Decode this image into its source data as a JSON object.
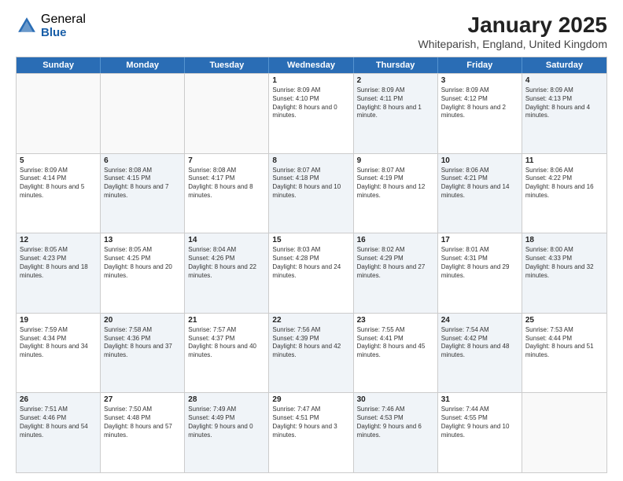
{
  "logo": {
    "general": "General",
    "blue": "Blue"
  },
  "title": {
    "month": "January 2025",
    "location": "Whiteparish, England, United Kingdom"
  },
  "header_days": [
    "Sunday",
    "Monday",
    "Tuesday",
    "Wednesday",
    "Thursday",
    "Friday",
    "Saturday"
  ],
  "weeks": [
    [
      {
        "day": "",
        "sunrise": "",
        "sunset": "",
        "daylight": "",
        "shaded": false,
        "empty": true
      },
      {
        "day": "",
        "sunrise": "",
        "sunset": "",
        "daylight": "",
        "shaded": false,
        "empty": true
      },
      {
        "day": "",
        "sunrise": "",
        "sunset": "",
        "daylight": "",
        "shaded": false,
        "empty": true
      },
      {
        "day": "1",
        "sunrise": "Sunrise: 8:09 AM",
        "sunset": "Sunset: 4:10 PM",
        "daylight": "Daylight: 8 hours and 0 minutes.",
        "shaded": false,
        "empty": false
      },
      {
        "day": "2",
        "sunrise": "Sunrise: 8:09 AM",
        "sunset": "Sunset: 4:11 PM",
        "daylight": "Daylight: 8 hours and 1 minute.",
        "shaded": true,
        "empty": false
      },
      {
        "day": "3",
        "sunrise": "Sunrise: 8:09 AM",
        "sunset": "Sunset: 4:12 PM",
        "daylight": "Daylight: 8 hours and 2 minutes.",
        "shaded": false,
        "empty": false
      },
      {
        "day": "4",
        "sunrise": "Sunrise: 8:09 AM",
        "sunset": "Sunset: 4:13 PM",
        "daylight": "Daylight: 8 hours and 4 minutes.",
        "shaded": true,
        "empty": false
      }
    ],
    [
      {
        "day": "5",
        "sunrise": "Sunrise: 8:09 AM",
        "sunset": "Sunset: 4:14 PM",
        "daylight": "Daylight: 8 hours and 5 minutes.",
        "shaded": false,
        "empty": false
      },
      {
        "day": "6",
        "sunrise": "Sunrise: 8:08 AM",
        "sunset": "Sunset: 4:15 PM",
        "daylight": "Daylight: 8 hours and 7 minutes.",
        "shaded": true,
        "empty": false
      },
      {
        "day": "7",
        "sunrise": "Sunrise: 8:08 AM",
        "sunset": "Sunset: 4:17 PM",
        "daylight": "Daylight: 8 hours and 8 minutes.",
        "shaded": false,
        "empty": false
      },
      {
        "day": "8",
        "sunrise": "Sunrise: 8:07 AM",
        "sunset": "Sunset: 4:18 PM",
        "daylight": "Daylight: 8 hours and 10 minutes.",
        "shaded": true,
        "empty": false
      },
      {
        "day": "9",
        "sunrise": "Sunrise: 8:07 AM",
        "sunset": "Sunset: 4:19 PM",
        "daylight": "Daylight: 8 hours and 12 minutes.",
        "shaded": false,
        "empty": false
      },
      {
        "day": "10",
        "sunrise": "Sunrise: 8:06 AM",
        "sunset": "Sunset: 4:21 PM",
        "daylight": "Daylight: 8 hours and 14 minutes.",
        "shaded": true,
        "empty": false
      },
      {
        "day": "11",
        "sunrise": "Sunrise: 8:06 AM",
        "sunset": "Sunset: 4:22 PM",
        "daylight": "Daylight: 8 hours and 16 minutes.",
        "shaded": false,
        "empty": false
      }
    ],
    [
      {
        "day": "12",
        "sunrise": "Sunrise: 8:05 AM",
        "sunset": "Sunset: 4:23 PM",
        "daylight": "Daylight: 8 hours and 18 minutes.",
        "shaded": true,
        "empty": false
      },
      {
        "day": "13",
        "sunrise": "Sunrise: 8:05 AM",
        "sunset": "Sunset: 4:25 PM",
        "daylight": "Daylight: 8 hours and 20 minutes.",
        "shaded": false,
        "empty": false
      },
      {
        "day": "14",
        "sunrise": "Sunrise: 8:04 AM",
        "sunset": "Sunset: 4:26 PM",
        "daylight": "Daylight: 8 hours and 22 minutes.",
        "shaded": true,
        "empty": false
      },
      {
        "day": "15",
        "sunrise": "Sunrise: 8:03 AM",
        "sunset": "Sunset: 4:28 PM",
        "daylight": "Daylight: 8 hours and 24 minutes.",
        "shaded": false,
        "empty": false
      },
      {
        "day": "16",
        "sunrise": "Sunrise: 8:02 AM",
        "sunset": "Sunset: 4:29 PM",
        "daylight": "Daylight: 8 hours and 27 minutes.",
        "shaded": true,
        "empty": false
      },
      {
        "day": "17",
        "sunrise": "Sunrise: 8:01 AM",
        "sunset": "Sunset: 4:31 PM",
        "daylight": "Daylight: 8 hours and 29 minutes.",
        "shaded": false,
        "empty": false
      },
      {
        "day": "18",
        "sunrise": "Sunrise: 8:00 AM",
        "sunset": "Sunset: 4:33 PM",
        "daylight": "Daylight: 8 hours and 32 minutes.",
        "shaded": true,
        "empty": false
      }
    ],
    [
      {
        "day": "19",
        "sunrise": "Sunrise: 7:59 AM",
        "sunset": "Sunset: 4:34 PM",
        "daylight": "Daylight: 8 hours and 34 minutes.",
        "shaded": false,
        "empty": false
      },
      {
        "day": "20",
        "sunrise": "Sunrise: 7:58 AM",
        "sunset": "Sunset: 4:36 PM",
        "daylight": "Daylight: 8 hours and 37 minutes.",
        "shaded": true,
        "empty": false
      },
      {
        "day": "21",
        "sunrise": "Sunrise: 7:57 AM",
        "sunset": "Sunset: 4:37 PM",
        "daylight": "Daylight: 8 hours and 40 minutes.",
        "shaded": false,
        "empty": false
      },
      {
        "day": "22",
        "sunrise": "Sunrise: 7:56 AM",
        "sunset": "Sunset: 4:39 PM",
        "daylight": "Daylight: 8 hours and 42 minutes.",
        "shaded": true,
        "empty": false
      },
      {
        "day": "23",
        "sunrise": "Sunrise: 7:55 AM",
        "sunset": "Sunset: 4:41 PM",
        "daylight": "Daylight: 8 hours and 45 minutes.",
        "shaded": false,
        "empty": false
      },
      {
        "day": "24",
        "sunrise": "Sunrise: 7:54 AM",
        "sunset": "Sunset: 4:42 PM",
        "daylight": "Daylight: 8 hours and 48 minutes.",
        "shaded": true,
        "empty": false
      },
      {
        "day": "25",
        "sunrise": "Sunrise: 7:53 AM",
        "sunset": "Sunset: 4:44 PM",
        "daylight": "Daylight: 8 hours and 51 minutes.",
        "shaded": false,
        "empty": false
      }
    ],
    [
      {
        "day": "26",
        "sunrise": "Sunrise: 7:51 AM",
        "sunset": "Sunset: 4:46 PM",
        "daylight": "Daylight: 8 hours and 54 minutes.",
        "shaded": true,
        "empty": false
      },
      {
        "day": "27",
        "sunrise": "Sunrise: 7:50 AM",
        "sunset": "Sunset: 4:48 PM",
        "daylight": "Daylight: 8 hours and 57 minutes.",
        "shaded": false,
        "empty": false
      },
      {
        "day": "28",
        "sunrise": "Sunrise: 7:49 AM",
        "sunset": "Sunset: 4:49 PM",
        "daylight": "Daylight: 9 hours and 0 minutes.",
        "shaded": true,
        "empty": false
      },
      {
        "day": "29",
        "sunrise": "Sunrise: 7:47 AM",
        "sunset": "Sunset: 4:51 PM",
        "daylight": "Daylight: 9 hours and 3 minutes.",
        "shaded": false,
        "empty": false
      },
      {
        "day": "30",
        "sunrise": "Sunrise: 7:46 AM",
        "sunset": "Sunset: 4:53 PM",
        "daylight": "Daylight: 9 hours and 6 minutes.",
        "shaded": true,
        "empty": false
      },
      {
        "day": "31",
        "sunrise": "Sunrise: 7:44 AM",
        "sunset": "Sunset: 4:55 PM",
        "daylight": "Daylight: 9 hours and 10 minutes.",
        "shaded": false,
        "empty": false
      },
      {
        "day": "",
        "sunrise": "",
        "sunset": "",
        "daylight": "",
        "shaded": true,
        "empty": true
      }
    ]
  ]
}
